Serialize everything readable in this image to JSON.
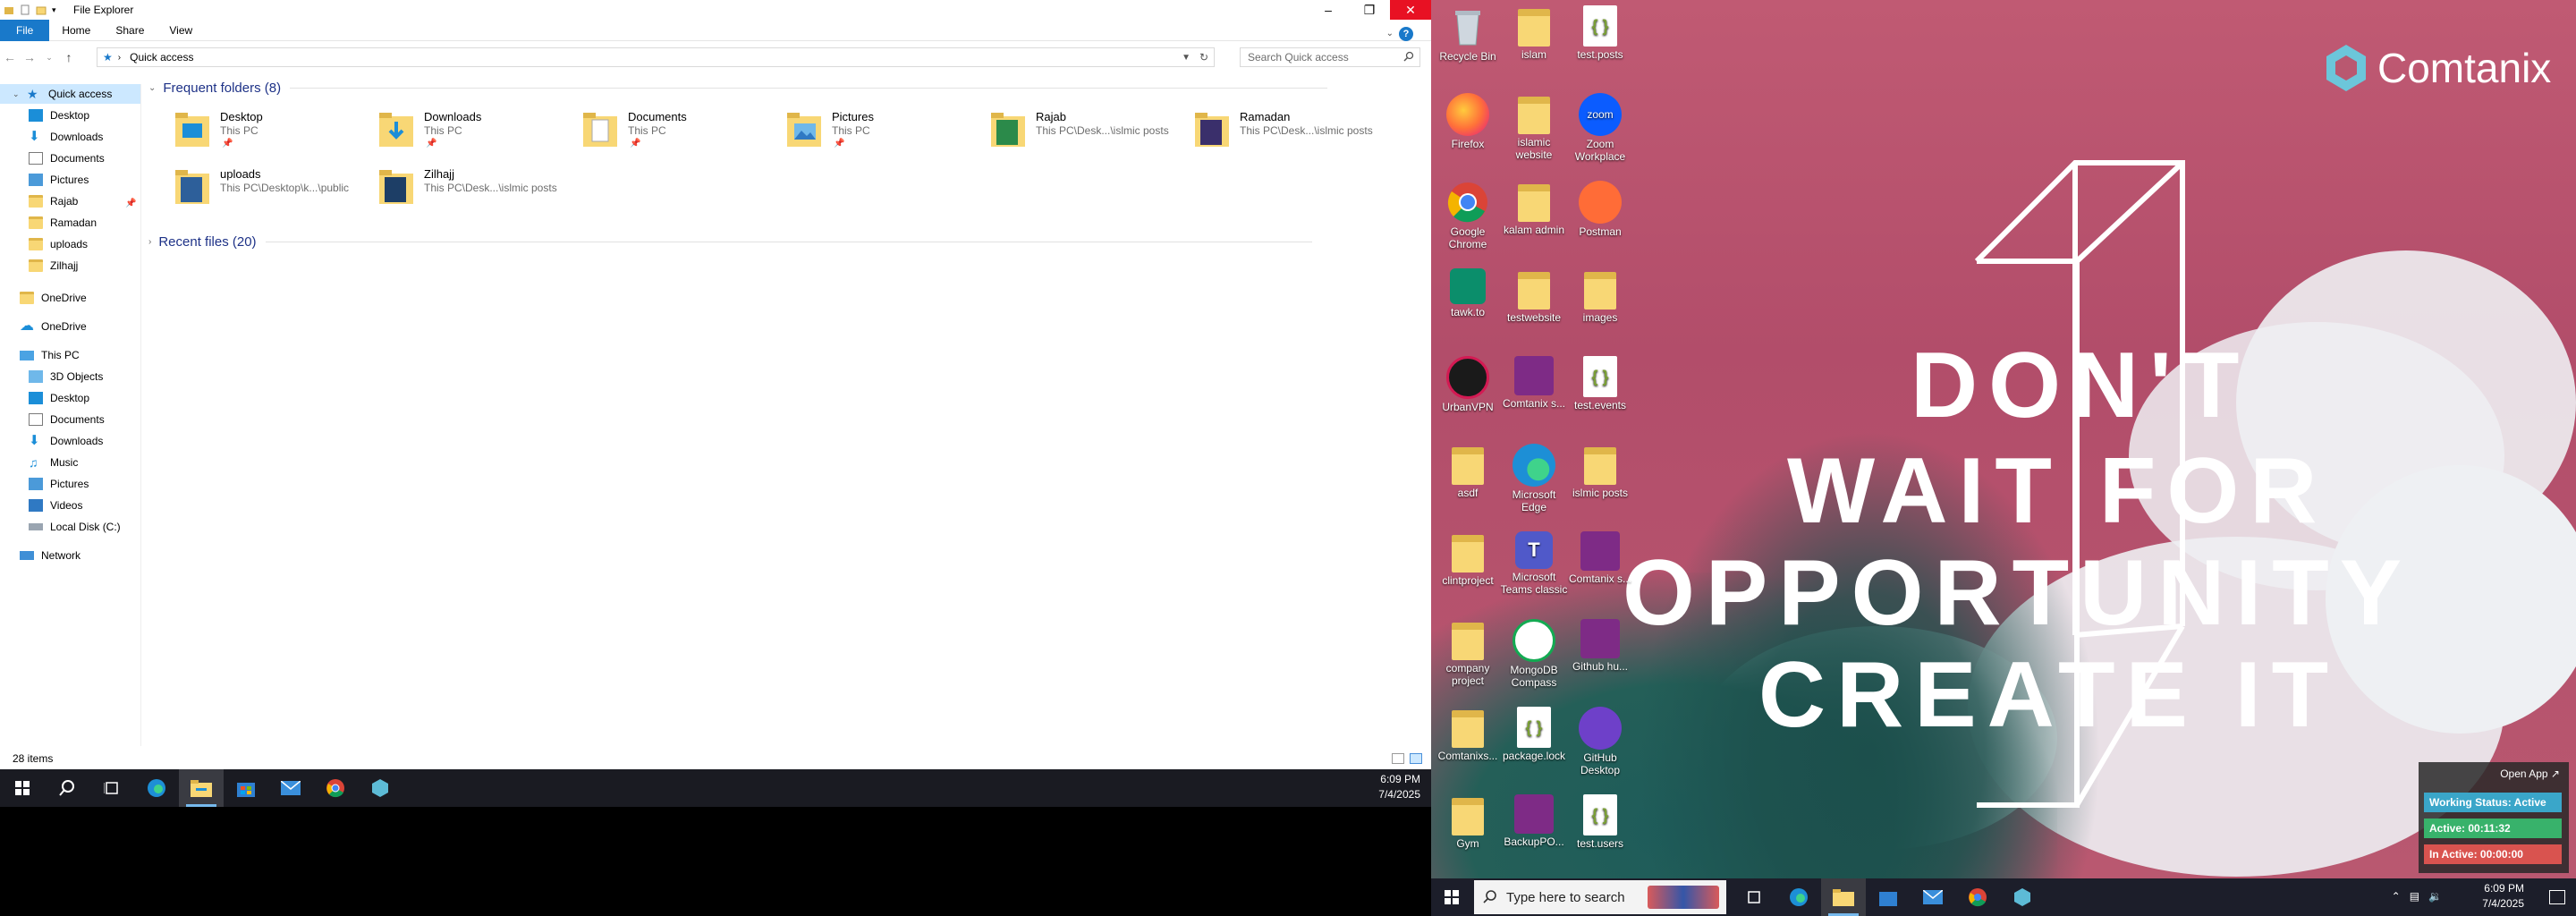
{
  "explorer": {
    "title": "File Explorer",
    "ribbon_tabs": [
      "File",
      "Home",
      "Share",
      "View"
    ],
    "address_crumb": "Quick access",
    "search_placeholder": "Search Quick access",
    "help_label": "?",
    "nav": {
      "quick_access": "Quick access",
      "quick_items": [
        "Desktop",
        "Downloads",
        "Documents",
        "Pictures",
        "Rajab",
        "Ramadan",
        "uploads",
        "Zilhajj"
      ],
      "onedrive_personal": "OneDrive",
      "onedrive": "OneDrive",
      "this_pc": "This PC",
      "pc_items": [
        "3D Objects",
        "Desktop",
        "Documents",
        "Downloads",
        "Music",
        "Pictures",
        "Videos",
        "Local Disk (C:)"
      ],
      "network": "Network"
    },
    "frequent_header": "Frequent folders (8)",
    "recent_header": "Recent files (20)",
    "folders": [
      {
        "name": "Desktop",
        "location": "This PC",
        "pinned": true
      },
      {
        "name": "Downloads",
        "location": "This PC",
        "pinned": true
      },
      {
        "name": "Documents",
        "location": "This PC",
        "pinned": true
      },
      {
        "name": "Pictures",
        "location": "This PC",
        "pinned": true
      },
      {
        "name": "Rajab",
        "location": "This PC\\Desk...\\islmic posts",
        "pinned": false
      },
      {
        "name": "Ramadan",
        "location": "This PC\\Desk...\\islmic posts",
        "pinned": false
      },
      {
        "name": "uploads",
        "location": "This PC\\Desktop\\k...\\public",
        "pinned": false
      },
      {
        "name": "Zilhajj",
        "location": "This PC\\Desk...\\islmic posts",
        "pinned": false
      }
    ],
    "status_count": "28 items"
  },
  "left_clock": {
    "time": "6:09 PM",
    "date": "7/4/2025"
  },
  "desktop": {
    "icons": [
      {
        "label": "Recycle Bin",
        "kind": "recycle"
      },
      {
        "label": "islam",
        "kind": "folder"
      },
      {
        "label": "test.posts",
        "kind": "json"
      },
      {
        "label": "Firefox",
        "kind": "firefox"
      },
      {
        "label": "islamic website",
        "kind": "folder"
      },
      {
        "label": "Zoom Workplace",
        "kind": "zoom"
      },
      {
        "label": "Google Chrome",
        "kind": "chrome"
      },
      {
        "label": "kalam admin",
        "kind": "folder"
      },
      {
        "label": "Postman",
        "kind": "postman"
      },
      {
        "label": "tawk.to",
        "kind": "tawk"
      },
      {
        "label": "testwebsite",
        "kind": "folder"
      },
      {
        "label": "images",
        "kind": "folder"
      },
      {
        "label": "UrbanVPN",
        "kind": "vpn"
      },
      {
        "label": "Comtanix s...",
        "kind": "rar"
      },
      {
        "label": "test.events",
        "kind": "json"
      },
      {
        "label": "asdf",
        "kind": "folder"
      },
      {
        "label": "Microsoft Edge",
        "kind": "edge"
      },
      {
        "label": "islmic posts",
        "kind": "folder"
      },
      {
        "label": "clintproject",
        "kind": "folder"
      },
      {
        "label": "Microsoft Teams classic",
        "kind": "teams"
      },
      {
        "label": "Comtanix s...",
        "kind": "rar"
      },
      {
        "label": "company project",
        "kind": "folder"
      },
      {
        "label": "MongoDB Compass",
        "kind": "mongo"
      },
      {
        "label": "Github hu...",
        "kind": "rar"
      },
      {
        "label": "Comtanixs...",
        "kind": "folder"
      },
      {
        "label": "package.lock",
        "kind": "json"
      },
      {
        "label": "GitHub Desktop",
        "kind": "github"
      },
      {
        "label": "Gym",
        "kind": "folder"
      },
      {
        "label": "BackupPO...",
        "kind": "rar"
      },
      {
        "label": "test.users",
        "kind": "json"
      }
    ],
    "brand": "Comtanix",
    "quote_lines": [
      "DON'T",
      "WAIT FOR",
      "OPPORTUNITY",
      "CREATE IT"
    ]
  },
  "widget": {
    "open_app": "Open App ↗",
    "working_status": "Working Status: Active",
    "active": "Active: 00:11:32",
    "inactive": "In Active: 00:00:00",
    "colors": {
      "working": "#3aa6c9",
      "active": "#38b26b",
      "inactive": "#d9534f"
    }
  },
  "taskbar": {
    "search_placeholder": "Type here to search",
    "time": "6:09 PM",
    "date": "7/4/2025"
  }
}
